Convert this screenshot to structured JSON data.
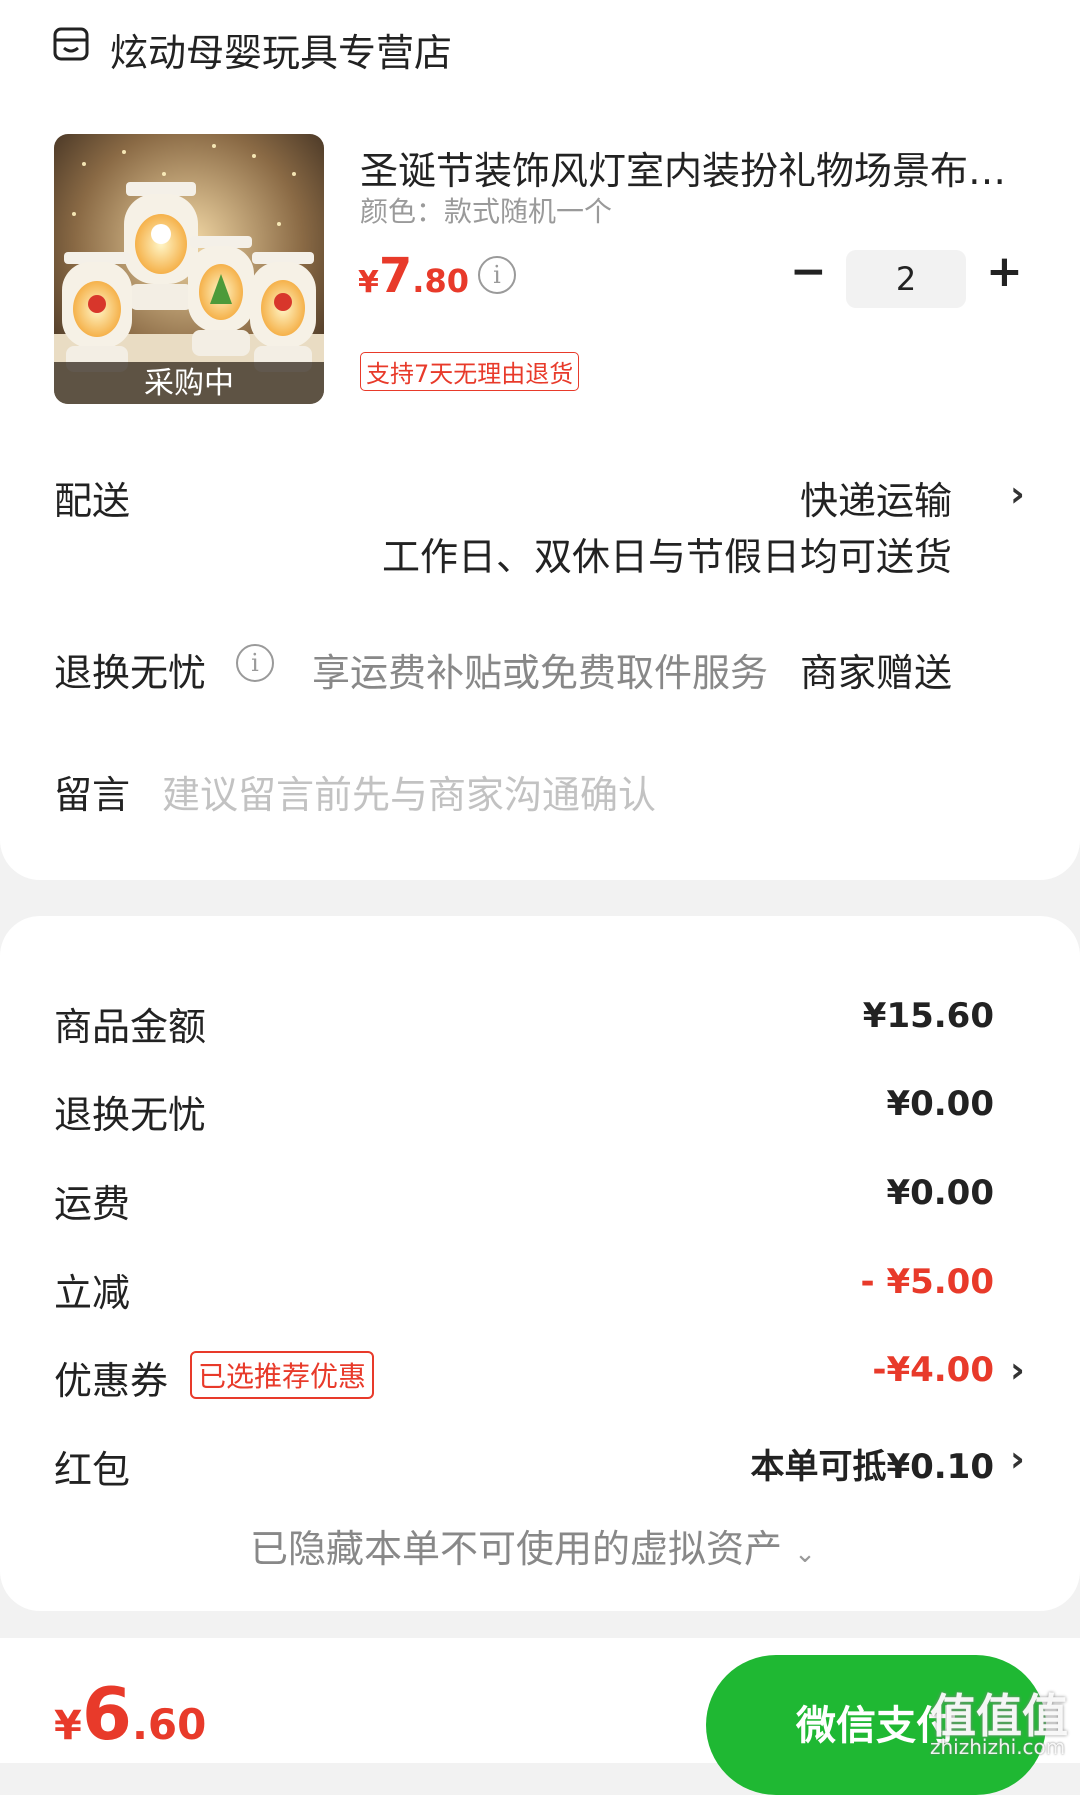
{
  "store": {
    "name": "炫动母婴玩具专营店",
    "icon": "store-icon"
  },
  "product": {
    "title": "圣诞节装饰风灯室内装扮礼物场景布…",
    "variant": "颜色：款式随机一个",
    "price_symbol": "¥",
    "price_int": "7",
    "price_dec": ".80",
    "quantity": "2",
    "thumb_tag": "采购中",
    "return_tag": "支持7天无理由退货"
  },
  "delivery": {
    "label": "配送",
    "method": "快递运输",
    "note": "工作日、双休日与节假日均可送货"
  },
  "return_worry": {
    "label": "退换无忧",
    "desc": "享运费补贴或免费取件服务",
    "value": "商家赠送"
  },
  "message": {
    "label": "留言",
    "placeholder": "建议留言前先与商家沟通确认"
  },
  "summary": {
    "rows": [
      {
        "label": "商品金额",
        "value": "¥15.60"
      },
      {
        "label": "退换无忧",
        "value": "¥0.00"
      },
      {
        "label": "运费",
        "value": "¥0.00"
      },
      {
        "label": "立减",
        "value": "- ¥5.00"
      },
      {
        "label": "优惠券",
        "value": "-¥4.00",
        "tag": "已选推荐优惠"
      },
      {
        "label": "红包",
        "value": "本单可抵¥0.10"
      }
    ],
    "hidden_note": "已隐藏本单不可使用的虚拟资产"
  },
  "footer": {
    "total_symbol": "¥",
    "total_int": "6",
    "total_dec": ".60",
    "pay_label": "微信支付",
    "watermark": "值值值",
    "watermark_sub": "zhizhizhi.com"
  },
  "colors": {
    "accent_red": "#e83a2a",
    "wechat_green": "#1fb833"
  }
}
